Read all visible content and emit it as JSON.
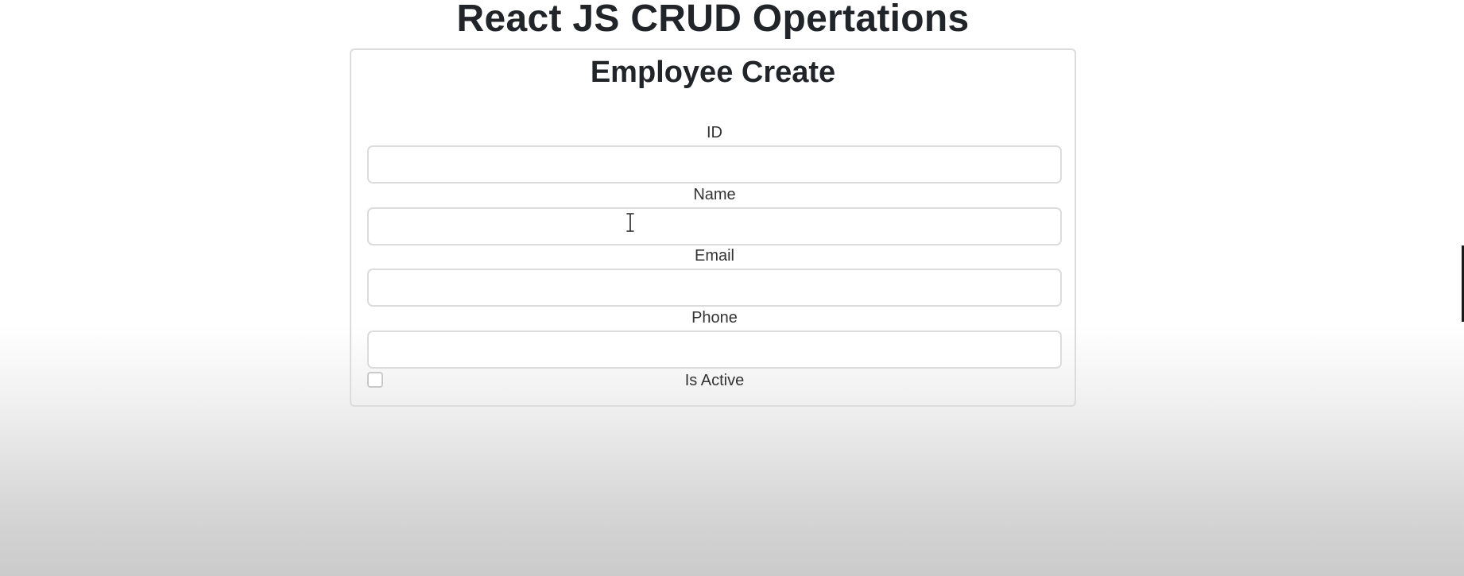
{
  "header": {
    "title": "React JS CRUD Opertations"
  },
  "form": {
    "title": "Employee Create",
    "fields": {
      "id": {
        "label": "ID",
        "value": "",
        "placeholder": ""
      },
      "name": {
        "label": "Name",
        "value": "",
        "placeholder": ""
      },
      "email": {
        "label": "Email",
        "value": "",
        "placeholder": ""
      },
      "phone": {
        "label": "Phone",
        "value": "",
        "placeholder": ""
      }
    },
    "active": {
      "label": "Is Active",
      "checked": false
    }
  },
  "cursor": {
    "icon": "text-cursor-icon"
  }
}
